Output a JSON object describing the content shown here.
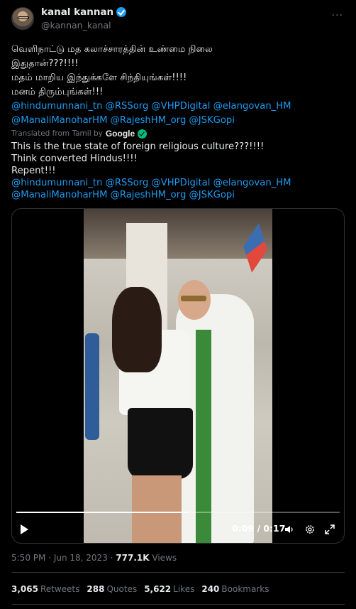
{
  "author": {
    "name": "kanal kannan",
    "handle": "@kannan_kanal",
    "more_label": "···"
  },
  "tweet": {
    "original_lines": [
      "வெளிநாட்டு மத கலாச்சாரத்தின் உண்மை நிலை",
      "இதுதான்???!!!!",
      "மதம் மாறிய இந்துக்களே சிந்தியுங்கள்!!!!",
      "மனம் திரும்புங்கள்!!!"
    ],
    "original_mentions": [
      "@hindumunnani_tn @RSSorg @VHPDigital @elangovan_HM",
      "@ManaliManoharHM @RajeshHM_org @JSKGopi"
    ],
    "translated_label": "Translated from Tamil by",
    "translator": "Google",
    "translated_lines": [
      "This is the true state of foreign religious culture???!!!!",
      "Think converted Hindus!!!!",
      "Repent!!!"
    ],
    "translated_mentions": [
      "@hindumunnani_tn @RSSorg @VHPDigital @elangovan_HM",
      "@ManaliManoharHM @RajeshHM_org @JSKGopi"
    ]
  },
  "video": {
    "time_display": "0:09 / 0:17",
    "progress_fraction": 0.53
  },
  "meta": {
    "time": "5:50 PM",
    "date": "Jun 18, 2023",
    "views_count": "777.1K",
    "views_label": "Views"
  },
  "stats": [
    {
      "count": "3,065",
      "label": "Retweets"
    },
    {
      "count": "288",
      "label": "Quotes"
    },
    {
      "count": "5,622",
      "label": "Likes"
    },
    {
      "count": "240",
      "label": "Bookmarks"
    }
  ],
  "colors": {
    "background": "#000000",
    "text": "#e7e9ea",
    "muted": "#71767b",
    "link": "#1d9bf0",
    "verified": "#1d9bf0"
  }
}
